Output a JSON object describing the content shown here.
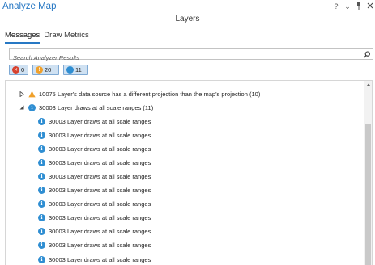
{
  "pane": {
    "title": "Analyze Map",
    "subtitle": "Layers",
    "controls": [
      "?",
      "⌄",
      "⊿",
      "✕"
    ]
  },
  "tabs": [
    {
      "label": "Messages",
      "active": true
    },
    {
      "label": "Draw Metrics",
      "active": false
    }
  ],
  "search": {
    "placeholder": "Search Analyzer Results",
    "value": ""
  },
  "filters": {
    "errors": {
      "count": "0",
      "color": "#d7402c"
    },
    "warnings": {
      "count": "20",
      "color": "#f0a02a"
    },
    "info": {
      "count": "11",
      "color": "#2f8ed2"
    }
  },
  "tree": {
    "group_warning": {
      "text": "10075 Layer's data source has a different projection than the map's projection (10)",
      "expanded": false
    },
    "group_info": {
      "text": "30003 Layer draws at all scale ranges (11)",
      "expanded": true
    },
    "items": [
      "30003 Layer draws at all scale ranges",
      "30003 Layer draws at all scale ranges",
      "30003 Layer draws at all scale ranges",
      "30003 Layer draws at all scale ranges",
      "30003 Layer draws at all scale ranges",
      "30003 Layer draws at all scale ranges",
      "30003 Layer draws at all scale ranges",
      "30003 Layer draws at all scale ranges",
      "30003 Layer draws at all scale ranges",
      "30003 Layer draws at all scale ranges",
      "30003 Layer draws at all scale ranges"
    ]
  }
}
